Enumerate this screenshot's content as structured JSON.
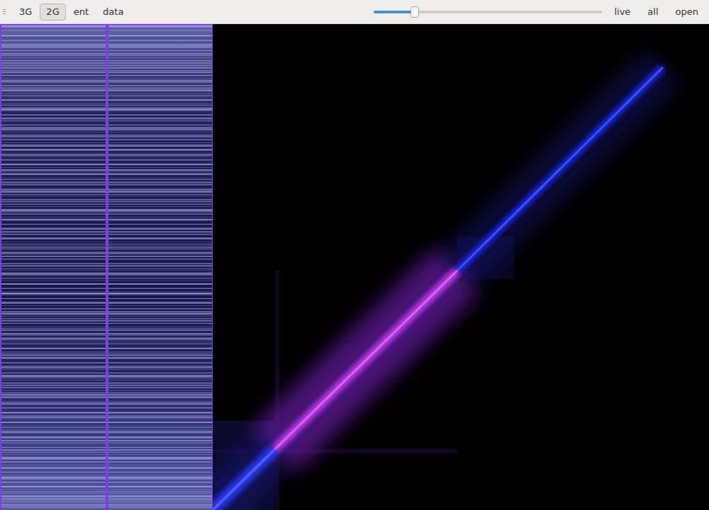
{
  "toolbar": {
    "modes": [
      {
        "label": "3G",
        "selected": false
      },
      {
        "label": "2G",
        "selected": true
      },
      {
        "label": "ent",
        "selected": false
      },
      {
        "label": "data",
        "selected": false
      }
    ],
    "slider": {
      "level": 0.18
    },
    "actions": [
      {
        "label": "live"
      },
      {
        "label": "all"
      },
      {
        "label": "open"
      }
    ]
  }
}
